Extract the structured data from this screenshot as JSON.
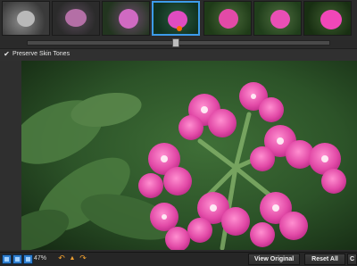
{
  "filmstrip": {
    "thumbnails": [
      {
        "id": "thumb-1",
        "style": "grayscale-low"
      },
      {
        "id": "thumb-2",
        "style": "muted-magenta"
      },
      {
        "id": "thumb-3",
        "style": "bright"
      },
      {
        "id": "thumb-4",
        "style": "vivid",
        "selected": true
      },
      {
        "id": "thumb-5",
        "style": "bright"
      },
      {
        "id": "thumb-6",
        "style": "bright"
      },
      {
        "id": "thumb-7",
        "style": "saturated"
      }
    ],
    "slider_value_percent": 49
  },
  "options": {
    "preserve_skin_tones_label": "Preserve Skin Tones",
    "preserve_skin_tones_checked": true
  },
  "bottom_bar": {
    "zoom": "47%",
    "view_original_label": "View Original",
    "reset_all_label": "Reset All",
    "cut_label": "C"
  },
  "colors": {
    "accent": "#3d9be9",
    "icon_orange": "#f0a030",
    "preview_bg": "#2f5a2c",
    "flower_pink": "#e24aa7"
  },
  "icons": {
    "check": "check-icon",
    "undo": "undo-icon",
    "redo": "redo-icon",
    "nav_up": "up-icon"
  }
}
